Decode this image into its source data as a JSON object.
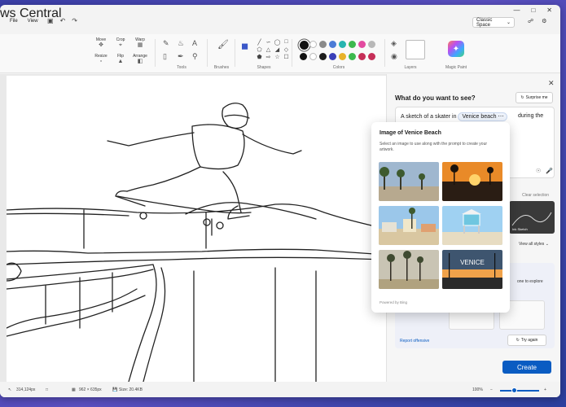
{
  "watermark": "ws Central",
  "titlebar": {
    "menu": [
      "File",
      "View"
    ],
    "space_label": "Classic Space"
  },
  "ribbon": {
    "selection": [
      "Move",
      "Crop",
      "Warp",
      "Resize",
      "Flip",
      "Arrange"
    ],
    "groups": {
      "tools": "Tools",
      "brushes": "Brushes",
      "shapes": "Shapes",
      "colors": "Colors",
      "layers": "Layers",
      "magic": "Magic Paint"
    },
    "colors_row1": [
      "#111111",
      "#ffffff",
      "#8a8a8a",
      "#4b7bd6",
      "#27b5b0",
      "#3db94e",
      "#e34aa0",
      "#b8b8b8"
    ],
    "colors_row2": [
      "#111111",
      "#ffffff",
      "#1c1c1c",
      "#3a3fb8",
      "#e8b22a",
      "#3db94e",
      "#c62f58",
      "#c62f58"
    ]
  },
  "statusbar": {
    "cursor": "314,124px",
    "size": "962 × 635px",
    "file_size": "Size: 20.4KB",
    "zoom": "100%"
  },
  "side_panel": {
    "title": "What do you want to see?",
    "surprise_label": "Surprise me",
    "prompt_prefix": "A sketch of a skater in",
    "prompt_chip": "Venice beach",
    "prompt_tail": "during the",
    "clear_selection": "Clear selection",
    "style_name": "Ink Sketch",
    "view_styles": "View all styles",
    "explore_text": "one to explore",
    "report_label": "Report offensive",
    "try_again": "Try again",
    "create_label": "Create"
  },
  "popup": {
    "title": "Image of Venice Beach",
    "desc": "Select an image to use along with the prompt to create your artwork.",
    "photo_text": "VENICE",
    "powered": "Powered by Bing"
  }
}
